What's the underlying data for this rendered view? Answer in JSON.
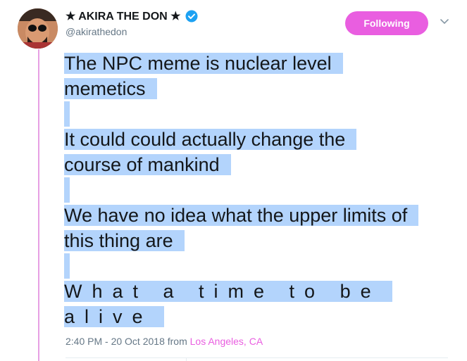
{
  "tweet": {
    "display_name": "★ AKIRA THE DON ★",
    "handle": "@akirathedon",
    "follow_label": "Following",
    "paragraphs": [
      [
        "The NPC meme is nuclear level",
        "memetics"
      ],
      [
        "It could could actually change the",
        "course of mankind"
      ],
      [
        "We have no idea what the upper limits of",
        "this thing are"
      ],
      [
        "What a time to be",
        "alive"
      ]
    ],
    "timestamp": "2:40 PM - 20 Oct 2018",
    "from_label": "from",
    "location": "Los Angeles, CA"
  },
  "colors": {
    "accent": "#e95ee0",
    "verified": "#1da1f2",
    "selection": "#b3d4fc"
  },
  "icons": {
    "verified": "verified-badge-icon",
    "caret": "chevron-down-icon"
  }
}
